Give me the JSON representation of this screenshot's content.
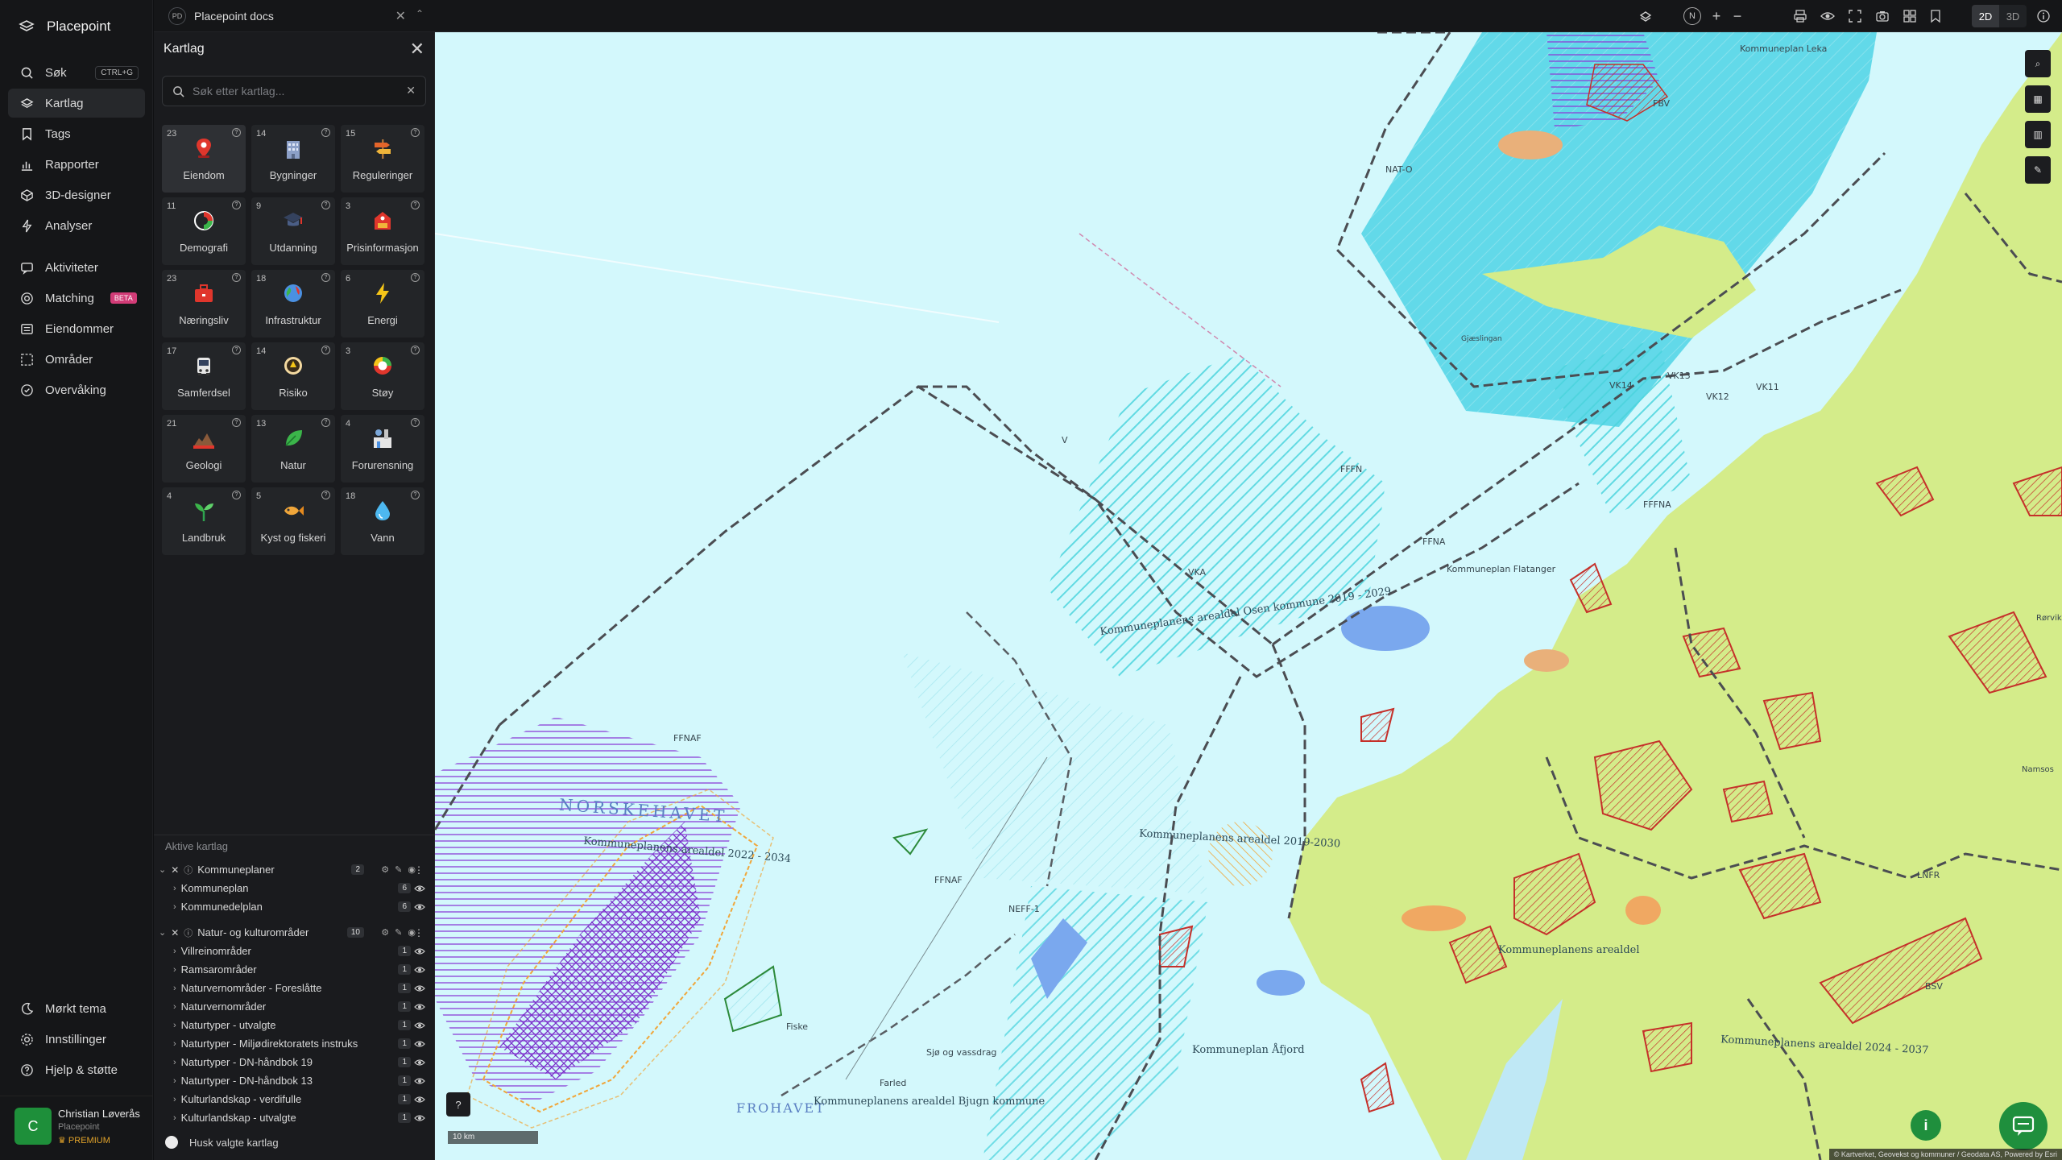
{
  "app": {
    "name": "Placepoint"
  },
  "nav": {
    "items": [
      {
        "label": "Søk",
        "icon": "search-icon",
        "shortcut": "CTRL+G"
      },
      {
        "label": "Kartlag",
        "icon": "layers-icon"
      },
      {
        "label": "Tags",
        "icon": "bookmark-icon"
      },
      {
        "label": "Rapporter",
        "icon": "bar-chart-icon"
      },
      {
        "label": "3D-designer",
        "icon": "cube-icon"
      },
      {
        "label": "Analyser",
        "icon": "bolt-icon"
      },
      {
        "label": "Aktiviteter",
        "icon": "chat-icon"
      },
      {
        "label": "Matching",
        "icon": "target-icon",
        "badge": "BETA"
      },
      {
        "label": "Eiendommer",
        "icon": "list-icon"
      },
      {
        "label": "Områder",
        "icon": "area-icon"
      },
      {
        "label": "Overvåking",
        "icon": "watch-icon"
      }
    ],
    "bottom": [
      {
        "label": "Mørkt tema",
        "icon": "moon-icon"
      },
      {
        "label": "Innstillinger",
        "icon": "gear-icon"
      },
      {
        "label": "Hjelp & støtte",
        "icon": "help-icon"
      }
    ]
  },
  "user": {
    "initial": "C",
    "name": "Christian Løverås",
    "org": "Placepoint",
    "plan": "PREMIUM"
  },
  "doc_tab": {
    "badge": "PD",
    "title": "Placepoint docs"
  },
  "panel": {
    "title": "Kartlag",
    "search_placeholder": "Søk etter kartlag...",
    "categories": [
      {
        "count": "23",
        "label": "Eiendom",
        "icon": "pin-icon",
        "active": true
      },
      {
        "count": "14",
        "label": "Bygninger",
        "icon": "building-icon"
      },
      {
        "count": "15",
        "label": "Reguleringer",
        "icon": "signpost-icon"
      },
      {
        "count": "11",
        "label": "Demografi",
        "icon": "demography-icon"
      },
      {
        "count": "9",
        "label": "Utdanning",
        "icon": "graduation-icon"
      },
      {
        "count": "3",
        "label": "Prisinformasjon",
        "icon": "price-tag-icon"
      },
      {
        "count": "23",
        "label": "Næringsliv",
        "icon": "briefcase-icon"
      },
      {
        "count": "18",
        "label": "Infrastruktur",
        "icon": "globe-icon"
      },
      {
        "count": "6",
        "label": "Energi",
        "icon": "lightning-icon"
      },
      {
        "count": "17",
        "label": "Samferdsel",
        "icon": "bus-icon"
      },
      {
        "count": "14",
        "label": "Risiko",
        "icon": "hazard-icon"
      },
      {
        "count": "3",
        "label": "Støy",
        "icon": "noise-icon"
      },
      {
        "count": "21",
        "label": "Geologi",
        "icon": "terrain-icon"
      },
      {
        "count": "13",
        "label": "Natur",
        "icon": "leaf-icon"
      },
      {
        "count": "4",
        "label": "Forurensning",
        "icon": "factory-icon"
      },
      {
        "count": "4",
        "label": "Landbruk",
        "icon": "sprout-icon"
      },
      {
        "count": "5",
        "label": "Kyst og fiskeri",
        "icon": "fish-icon"
      },
      {
        "count": "18",
        "label": "Vann",
        "icon": "water-drop-icon"
      }
    ],
    "active_header": "Aktive kartlag",
    "groups": [
      {
        "label": "Kommuneplaner",
        "count": "2",
        "children": [
          {
            "label": "Kommuneplan",
            "count": "6"
          },
          {
            "label": "Kommunedelplan",
            "count": "6"
          }
        ]
      },
      {
        "label": "Natur- og kulturområder",
        "count": "10",
        "children": [
          {
            "label": "Villreinområder",
            "count": "1"
          },
          {
            "label": "Ramsarområder",
            "count": "1"
          },
          {
            "label": "Naturvernområder - Foreslåtte",
            "count": "1"
          },
          {
            "label": "Naturvernområder",
            "count": "1"
          },
          {
            "label": "Naturtyper - utvalgte",
            "count": "1"
          },
          {
            "label": "Naturtyper - Miljødirektoratets instruks",
            "count": "1"
          },
          {
            "label": "Naturtyper - DN-håndbok 19",
            "count": "1"
          },
          {
            "label": "Naturtyper - DN-håndbok 13",
            "count": "1"
          },
          {
            "label": "Kulturlandskap - verdifulle",
            "count": "1"
          },
          {
            "label": "Kulturlandskap - utvalgte",
            "count": "1"
          }
        ]
      }
    ],
    "remember_label": "Husk valgte kartlag"
  },
  "toolbar": {
    "compass": "N",
    "zoom_in": "+",
    "zoom_out": "−",
    "mode_2d": "2D",
    "mode_3d": "3D",
    "active_mode": "2D"
  },
  "map": {
    "labels": [
      "Kommuneplan Leka",
      "FBV",
      "NAT-O",
      "FFFN",
      "FFNA",
      "VK13",
      "VK14",
      "VK12",
      "VK11",
      "VKA",
      "V",
      "Kommuneplanens arealdel Osen kommune 2019 - 2029",
      "Kommuneplan Flatanger",
      "FFFNA",
      "FFNAF",
      "NORSKEHAVET",
      "Kommuneplanens arealdel 2022 - 2034",
      "FFNAF",
      "Kommuneplanens arealdel 2019-2030",
      "NEFF-1",
      "Kommuneplanens arealdel 2024 - 2037",
      "Kommuneplanens arealdel",
      "Kommuneplan Åfjord",
      "FROHAVET",
      "Kommuneplanens arealdel Bjugn kommune",
      "Sjø og vassdrag",
      "Farled",
      "Fiske",
      "LNFR",
      "BSV",
      "Gjæslingan",
      "Rørvik",
      "Namsos"
    ],
    "scale": "10 km",
    "attribution": "© Kartverket, Geovekst og kommuner / Geodata AS, Powered by Esri"
  },
  "colors": {
    "sea": "#cdf7fb",
    "land": "#d7ec8e",
    "accent": "#1f8f3d",
    "purple": "#7a39c9",
    "red_hatch": "#c5302a",
    "teal_hatch": "#45d2dc"
  }
}
